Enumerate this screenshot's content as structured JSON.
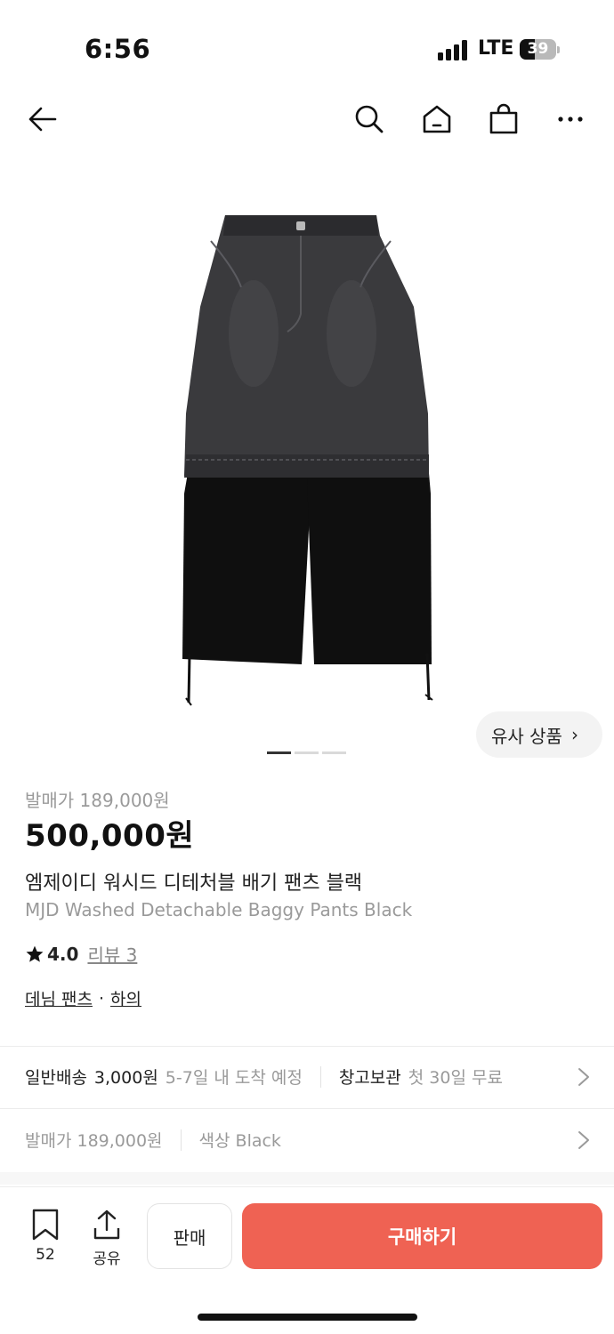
{
  "status_bar": {
    "time": "6:56",
    "network": "LTE",
    "battery": "39"
  },
  "nav": {
    "icons": [
      "back-arrow-icon",
      "search-icon",
      "home-icon",
      "shopping-bag-icon",
      "more-icon"
    ]
  },
  "gallery": {
    "similar_label": "유사 상품",
    "similar_chevron": "›",
    "pages": 3,
    "current_page": 1
  },
  "product": {
    "release_price_label": "발매가 189,000원",
    "price": "500,000원",
    "name_ko": "엠제이디 워시드 디테처블 배기 팬츠 블랙",
    "name_en": "MJD Washed Detachable Baggy Pants Black",
    "rating": "4.0",
    "reviews": "리뷰 3",
    "category_primary": "데님 팬츠",
    "category_separator": "·",
    "category_secondary": "하의"
  },
  "shipping": {
    "type": "일반배송",
    "cost": "3,000원",
    "eta": "5-7일 내 도착 예정",
    "storage_label": "창고보관",
    "storage_detail": "첫 30일 무료"
  },
  "options": {
    "release_price": "발매가 189,000원",
    "color": "색상 Black"
  },
  "bottom_bar": {
    "bookmark_count": "52",
    "share_label": "공유",
    "sell_label": "판매",
    "buy_label": "구매하기",
    "buy_color": "#ef6253"
  }
}
